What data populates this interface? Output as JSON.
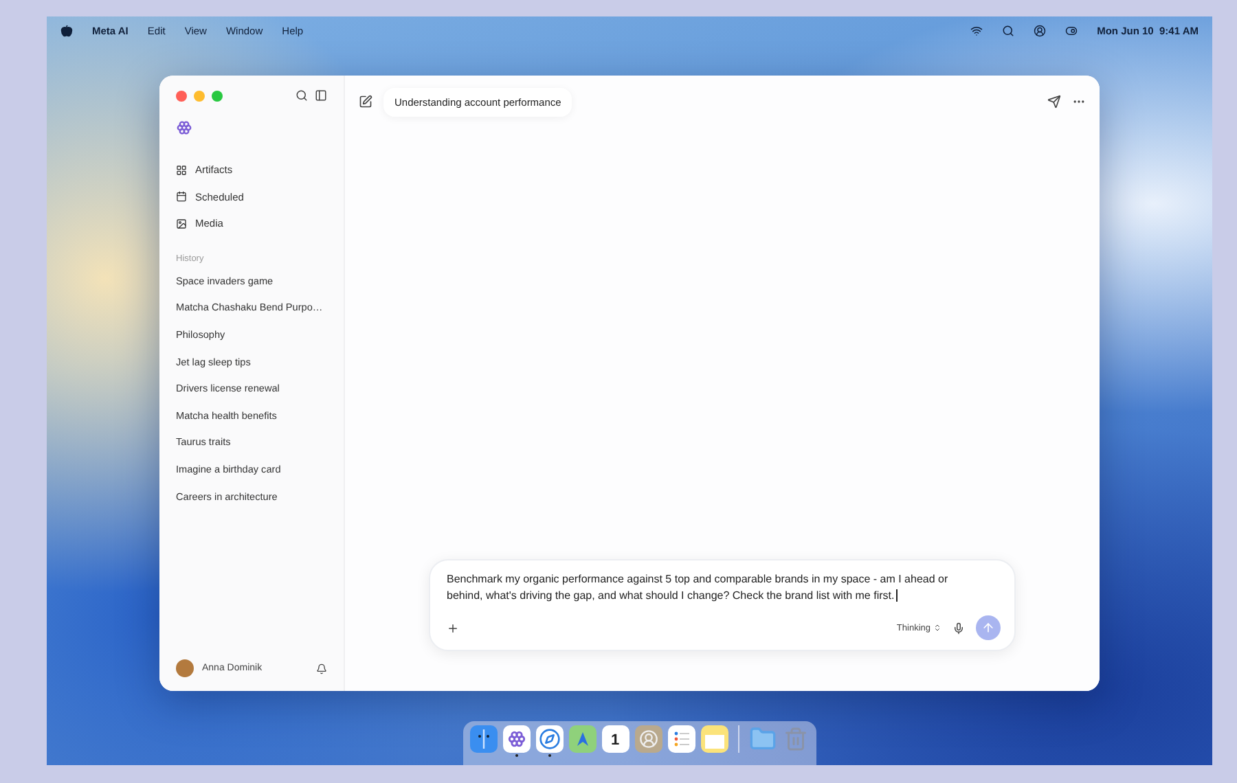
{
  "menu_bar": {
    "app_name": "Meta AI",
    "menus": [
      "Edit",
      "View",
      "Window",
      "Help"
    ],
    "clock": "Mon Jun 10  9:41 AM"
  },
  "window": {
    "title": "Understanding account performance"
  },
  "sidebar": {
    "nav_items": [
      {
        "label": "Artifacts",
        "kind": "grid"
      },
      {
        "label": "Scheduled",
        "kind": "calendar"
      },
      {
        "label": "Media",
        "kind": "image"
      }
    ],
    "history_label": "History",
    "history": [
      "Space invaders game",
      "Matcha Chashaku Bend Purpo…",
      "Philosophy",
      "Jet lag sleep tips",
      "Drivers license renewal",
      "Matcha health benefits",
      "Taurus traits",
      "Imagine a birthday card",
      "Careers in architecture"
    ],
    "user": {
      "name": "Anna Dominik"
    }
  },
  "composer": {
    "value": "Benchmark my organic performance against 5 top and comparable brands in my space - am I ahead or behind, what's driving the gap, and what should I change? Check the brand list with me first.",
    "mode": "Thinking"
  },
  "dock": {
    "apps": [
      {
        "kind": "finder",
        "running": false
      },
      {
        "kind": "meta",
        "running": true
      },
      {
        "kind": "safari",
        "running": true
      },
      {
        "kind": "maps",
        "running": false
      },
      {
        "kind": "calendar",
        "running": false,
        "day": "1"
      },
      {
        "kind": "contacts",
        "running": false
      },
      {
        "kind": "reminders",
        "running": false
      },
      {
        "kind": "notes",
        "running": false
      },
      {
        "kind": "folder",
        "running": false
      },
      {
        "kind": "trash",
        "running": false
      }
    ]
  }
}
